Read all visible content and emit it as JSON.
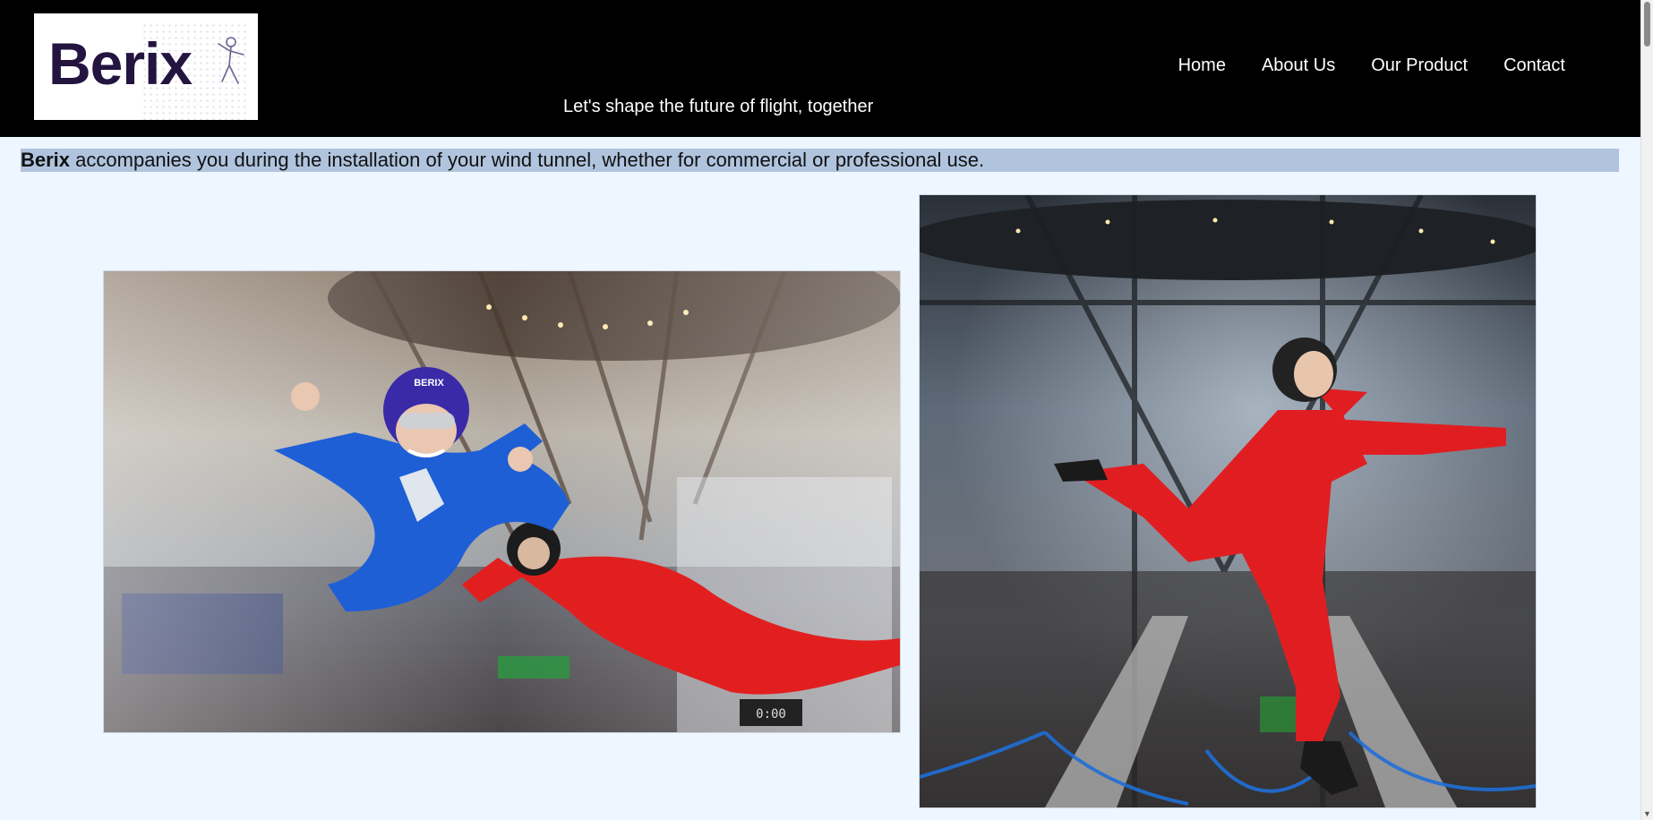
{
  "header": {
    "logo_alt": "Berix logo",
    "logo_text": "Berix",
    "tagline": "Let's shape the future of flight, together",
    "nav": [
      {
        "label": "Home"
      },
      {
        "label": "About Us"
      },
      {
        "label": "Our Product"
      },
      {
        "label": "Contact"
      }
    ]
  },
  "intro": {
    "brand": "Berix",
    "text": " accompanies you during the installation of your wind tunnel, whether for commercial or professional use."
  },
  "photos": [
    {
      "alt": "Two indoor skydivers in blue and red suits flying in a wind tunnel",
      "helmet_text": "BERIX",
      "timer": "0:00"
    },
    {
      "alt": "Indoor skydiver in red suit posing in a glass wind tunnel"
    }
  ],
  "colors": {
    "header_bg": "#000000",
    "page_bg": "#eef6ff",
    "intro_bg": "#b0c4de",
    "logo_purple": "#231440"
  }
}
